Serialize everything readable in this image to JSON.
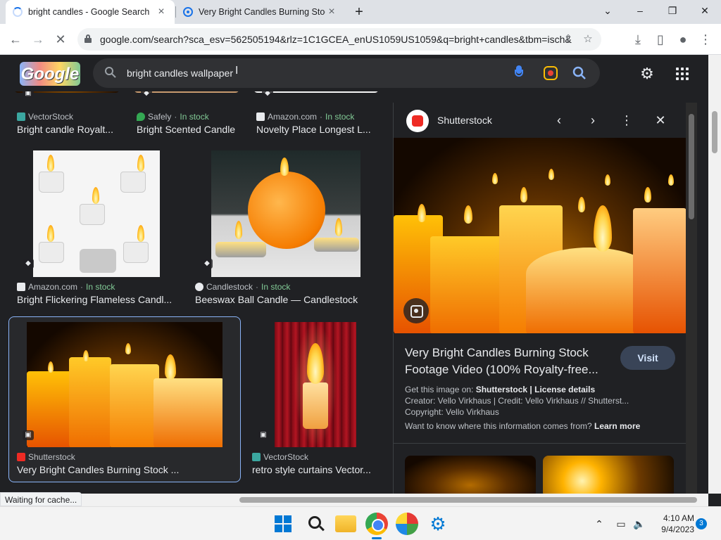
{
  "browser": {
    "tabs": [
      {
        "title": "bright candles - Google Search",
        "loading": true
      },
      {
        "title": "Very Bright Candles Burning Stoc",
        "loading": false
      }
    ],
    "new_tab_icon": "plus-icon",
    "window_controls": {
      "minimize": "–",
      "maximize": "❐",
      "close": "✕",
      "tab_search": "⌄"
    },
    "url": "google.com/search?sca_esv=562505194&rlz=1C1GCEA_enUS1059US1059&q=bright+candles&tbm=isch&..."
  },
  "google": {
    "logo_text": "Google",
    "search_value": "bright candles wallpaper"
  },
  "results": [
    {
      "source": "VectorStock",
      "in_stock": "",
      "title": "Bright candle Royalt...",
      "fav_color": "#3ba7a0"
    },
    {
      "source": "Safely",
      "in_stock": "In stock",
      "title": "Bright Scented Candle",
      "fav_color": "#34a853"
    },
    {
      "source": "Amazon.com",
      "in_stock": "In stock",
      "title": "Novelty Place Longest L...",
      "fav_color": "#e8eaed"
    },
    {
      "source": "Amazon.com",
      "in_stock": "In stock",
      "title": "Bright Flickering Flameless Candl...",
      "fav_color": "#e8eaed"
    },
    {
      "source": "Candlestock",
      "in_stock": "In stock",
      "title": "Beeswax Ball Candle — Candlestock",
      "fav_color": "#e8eaed"
    },
    {
      "source": "Shutterstock",
      "in_stock": "",
      "title": "Very Bright Candles Burning Stock ...",
      "fav_color": "#ee2b24"
    },
    {
      "source": "VectorStock",
      "in_stock": "",
      "title": "retro style curtains Vector...",
      "fav_color": "#3ba7a0"
    }
  ],
  "dot_separator": "·",
  "panel": {
    "source_name": "Shutterstock",
    "title": "Very Bright Candles Burning Stock Footage Video (100% Royalty-free...",
    "visit_label": "Visit",
    "get_image_prefix": "Get this image on: ",
    "get_image_source": "Shutterstock",
    "license_sep": " | ",
    "license_label": "License details",
    "creator": "Creator: Vello Virkhaus | Credit: Vello Virkhaus // Shutterst...",
    "copyright": "Copyright: Vello Virkhaus",
    "want_to_know": "Want to know where this information comes from? ",
    "learn_more": "Learn more"
  },
  "status": "Waiting for cache...",
  "taskbar": {
    "time": "4:10 AM",
    "date": "9/4/2023",
    "notifications": "3"
  }
}
